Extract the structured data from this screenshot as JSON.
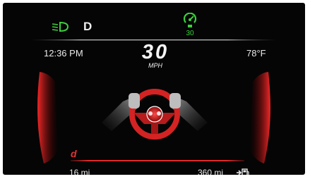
{
  "status": {
    "gear": "D",
    "cruise_speed": "30",
    "headlight_icon": "low-beam-headlight-icon",
    "cruise_icon": "adaptive-cruise-icon",
    "indicator_color": "#3ccf3c"
  },
  "info": {
    "time": "12:36 PM",
    "outside_temp": "78°F"
  },
  "speed": {
    "value": "30",
    "unit": "MPH"
  },
  "drive_mode": {
    "label": "d",
    "color": "#e53434"
  },
  "trip": {
    "distance": "16 mi",
    "range": "360 mi"
  },
  "colors": {
    "accent": "#e02a2a",
    "background": "#050505"
  }
}
